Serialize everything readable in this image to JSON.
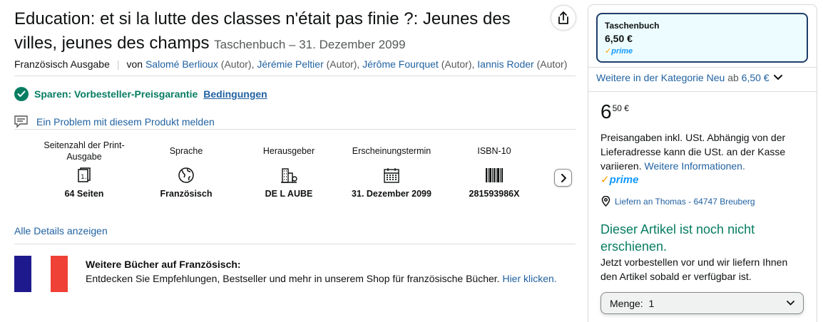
{
  "product": {
    "title": "Education: et si la lutte des classes n'était pas finie ?: Jeunes des villes, jeunes des champs",
    "format_date": "Taschenbuch – 31. Dezember 2099",
    "edition": "Französisch Ausgabe",
    "by": "von",
    "authors": [
      {
        "name": "Salomé Berlioux",
        "role": "(Autor),"
      },
      {
        "name": "Jérémie Peltier",
        "role": "(Autor),"
      },
      {
        "name": "Jérôme Fourquet",
        "role": "(Autor),"
      },
      {
        "name": "Iannis Roder",
        "role": "(Autor)"
      }
    ]
  },
  "savings": {
    "text": "Sparen: Vorbesteller-Preisgarantie",
    "link": "Bedingungen"
  },
  "report_link": "Ein Problem mit diesem Produkt melden",
  "details": [
    {
      "label": "Seitenzahl der Print-Ausgabe",
      "icon": "page-count-icon",
      "value": "64 Seiten"
    },
    {
      "label": "Sprache",
      "icon": "globe-icon",
      "value": "Französisch"
    },
    {
      "label": "Herausgeber",
      "icon": "building-icon",
      "value": "DE L AUBE"
    },
    {
      "label": "Erscheinungstermin",
      "icon": "calendar-icon",
      "value": "31. Dezember 2099"
    },
    {
      "label": "ISBN-10",
      "icon": "barcode-icon",
      "value": "281593986X"
    }
  ],
  "all_details": "Alle Details anzeigen",
  "promo": {
    "heading": "Weitere Bücher auf Französisch:",
    "text": "Entdecken Sie Empfehlungen, Bestseller und mehr in unserem Shop für französische Bücher.",
    "link": "Hier klicken."
  },
  "buybox": {
    "format_name": "Taschenbuch",
    "format_price": "6,50 €",
    "prime_label": "prime",
    "more_text": "Weitere in der Kategorie Neu",
    "more_from": "ab",
    "more_price": "6,50 €",
    "price_whole": "6",
    "price_frac": "50 €",
    "tax_text": "Preisangaben inkl. USt. Abhängig von der Lieferadresse kann die USt. an der Kasse variieren.",
    "tax_link": "Weitere Informationen.",
    "deliver_text": "Liefern an Thomas - 64747 Breuberg",
    "availability": "Dieser Artikel ist noch nicht erschienen.",
    "availability_sub": "Jetzt vorbestellen vor und wir liefern Ihnen den Artikel sobald er verfügbar ist.",
    "qty_label": "Menge:",
    "qty_value": "1"
  },
  "colors": {
    "link": "#2162a1",
    "green": "#067d62",
    "prime_blue": "#1399ff",
    "prime_orange": "#ff9900",
    "flag_blue": "#1e1a8e",
    "flag_red": "#ef4135"
  }
}
